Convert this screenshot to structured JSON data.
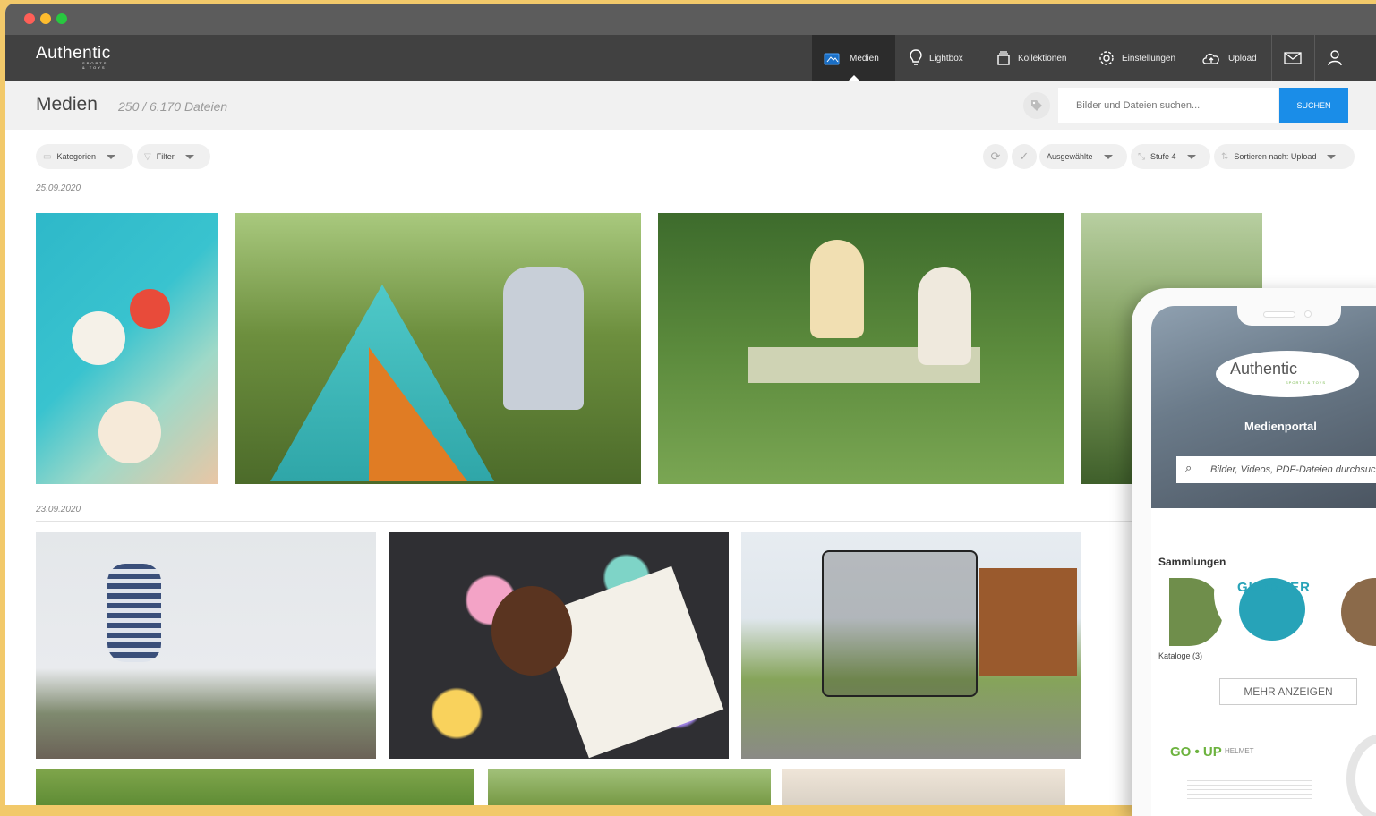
{
  "nav": {
    "logo": "Authentic",
    "logo_sub": "SPORTS & TOYS",
    "items": [
      {
        "label": "Medien",
        "icon": "media-icon"
      },
      {
        "label": "Lightbox",
        "icon": "lightbulb-icon"
      },
      {
        "label": "Kollektionen",
        "icon": "collection-icon"
      },
      {
        "label": "Einstellungen",
        "icon": "gear-icon"
      },
      {
        "label": "Upload",
        "icon": "cloud-upload-icon"
      }
    ]
  },
  "header": {
    "title": "Medien",
    "count": "250 / 6.170 Dateien",
    "search_placeholder": "Bilder und Dateien suchen...",
    "search_button": "SUCHEN"
  },
  "toolbar": {
    "categories": "Kategorien",
    "filter": "Filter",
    "selected": "Ausgewählte",
    "level": "Stufe 4",
    "sort": "Sortieren nach: Upload"
  },
  "groups": [
    {
      "date": "25.09.2020"
    },
    {
      "date": "23.09.2020"
    }
  ],
  "phone": {
    "logo": "Authentic",
    "logo_sub": "SPORTS & TOYS",
    "title": "Medienportal",
    "search_placeholder": "Bilder, Videos, PDF-Dateien durchsuchen",
    "collections_heading": "Sammlungen",
    "collection_brand": "GLOBBER",
    "catalogs": "Kataloge (3)",
    "more_button": "MEHR ANZEIGEN",
    "goup": "GO • UP",
    "goup_sub": "HELMET"
  },
  "colors": {
    "accent": "#1a8de8",
    "nav_bg": "#414141",
    "brand_green": "#6db33f"
  }
}
